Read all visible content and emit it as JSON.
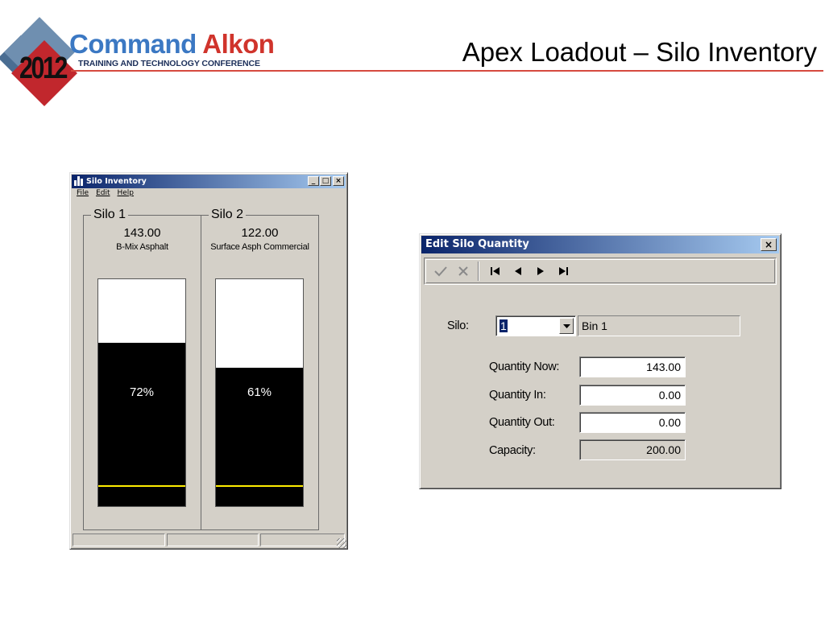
{
  "slide": {
    "logo_year": "2012",
    "brand_name_a": "Command",
    "brand_name_b": "Alkon",
    "brand_subtitle": "TRAINING AND TECHNOLOGY CONFERENCE",
    "title": "Apex Loadout – Silo Inventory",
    "colors": {
      "rule": "#d64a3f",
      "brand_blue": "#3b78c3",
      "brand_red": "#d0342c"
    }
  },
  "silo_window": {
    "title": "Silo Inventory",
    "controls": {
      "minimize": "_",
      "maximize": "□",
      "close": "×"
    },
    "menu": [
      "File",
      "Edit",
      "Help"
    ],
    "silos": [
      {
        "label": "Silo 1",
        "quantity": "143.00",
        "material": "B-Mix Asphalt",
        "percent_text": "72%",
        "fill_fraction": 0.72
      },
      {
        "label": "Silo 2",
        "quantity": "122.00",
        "material": "Surface Asph Commercial",
        "percent_text": "61%",
        "fill_fraction": 0.61
      }
    ],
    "colors": {
      "fill": "#000000",
      "empty": "#ffffff",
      "marker": "#ffee00"
    }
  },
  "edit_dialog": {
    "title": "Edit Silo Quantity",
    "close": "×",
    "toolbar": [
      "check-icon",
      "cancel-x-icon",
      "first-record-icon",
      "prev-record-icon",
      "next-record-icon",
      "last-record-icon"
    ],
    "silo_label": "Silo:",
    "silo_value": "1",
    "silo_name": "Bin 1",
    "quantity_now_label": "Quantity Now:",
    "quantity_now": "143.00",
    "quantity_in_label": "Quantity In:",
    "quantity_in": "0.00",
    "quantity_out_label": "Quantity Out:",
    "quantity_out": "0.00",
    "capacity_label": "Capacity:",
    "capacity": "200.00"
  }
}
